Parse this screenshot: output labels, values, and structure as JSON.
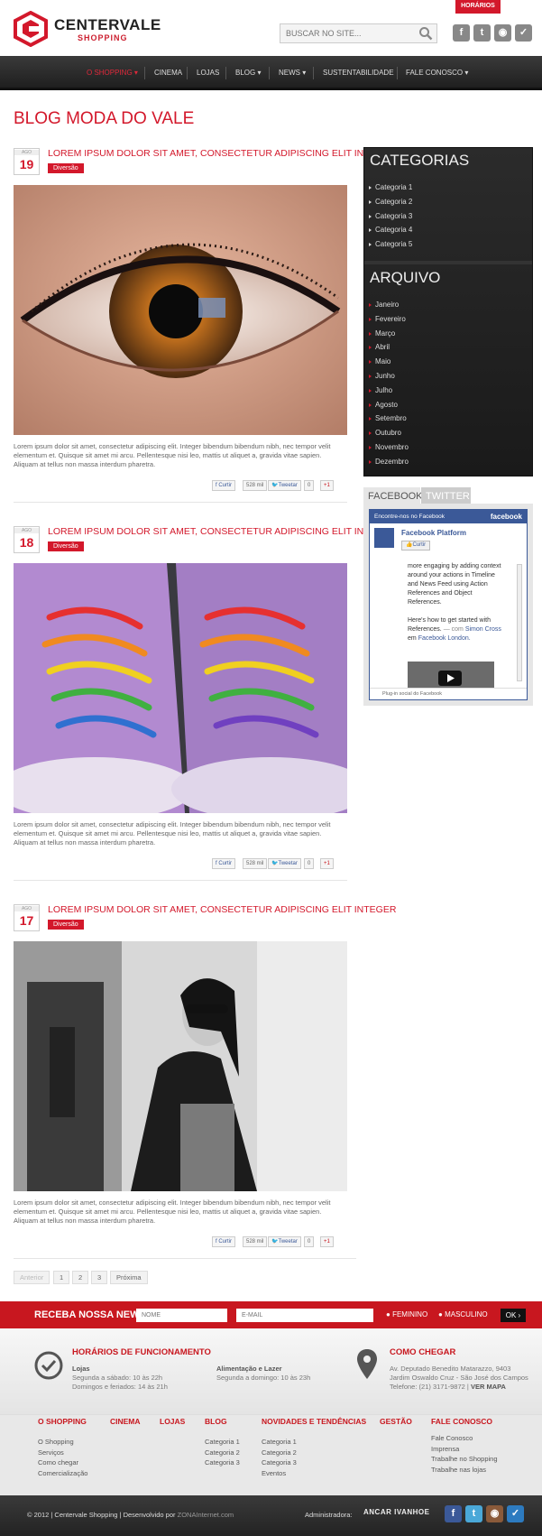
{
  "header": {
    "logo_title": "CENTERVALE",
    "logo_subtitle": "SHOPPING",
    "horarios_label": "HORÁRIOS",
    "search_placeholder": "BUSCAR NO SITE..."
  },
  "nav": [
    {
      "label": "O SHOPPING ▾",
      "active": true
    },
    {
      "label": "CINEMA"
    },
    {
      "label": "LOJAS"
    },
    {
      "label": "BLOG ▾"
    },
    {
      "label": "NEWS ▾"
    },
    {
      "label": "SUSTENTABILIDADE"
    },
    {
      "label": "FALE CONOSCO ▾"
    }
  ],
  "page_title": "BLOG MODA DO VALE",
  "posts": [
    {
      "month": "AGO",
      "day": "19",
      "title": "LOREM IPSUM DOLOR SIT AMET, CONSECTETUR ADIPISCING ELIT INTEGER",
      "category": "Diversão",
      "text": "Lorem ipsum dolor sit amet, consectetur adipiscing elit. Integer bibendum bibendum nibh, nec tempor velit elementum et. Quisque sit amet mi arcu. Pellentesque nisi leo, mattis ut aliquet a, gravida vitae sapien. Aliquam at tellus non massa interdum pharetra."
    },
    {
      "month": "AGO",
      "day": "18",
      "title": "LOREM IPSUM DOLOR SIT AMET, CONSECTETUR ADIPISCING ELIT INTEGER",
      "category": "Diversão",
      "text": "Lorem ipsum dolor sit amet, consectetur adipiscing elit. Integer bibendum bibendum nibh, nec tempor velit elementum et. Quisque sit amet mi arcu. Pellentesque nisi leo, mattis ut aliquet a, gravida vitae sapien. Aliquam at tellus non massa interdum pharetra."
    },
    {
      "month": "AGO",
      "day": "17",
      "title": "LOREM IPSUM DOLOR SIT AMET, CONSECTETUR ADIPISCING ELIT INTEGER",
      "category": "Diversão",
      "text": "Lorem ipsum dolor sit amet, consectetur adipiscing elit. Integer bibendum bibendum nibh, nec tempor velit elementum et. Quisque sit amet mi arcu. Pellentesque nisi leo, mattis ut aliquet a, gravida vitae sapien. Aliquam at tellus non massa interdum pharetra."
    }
  ],
  "share": {
    "curtir": "Curtir",
    "like_count": "528 mil",
    "tweet": "Tweetar",
    "tweet_count": "0",
    "plus": "+1"
  },
  "sidebar": {
    "categorias_title": "CATEGORIAS",
    "categorias": [
      "Categoria 1",
      "Categoria 2",
      "Categoria 3",
      "Categoria 4",
      "Categoria 5"
    ],
    "arquivo_title": "ARQUIVO",
    "arquivo": [
      "Janeiro",
      "Fevereiro",
      "Março",
      "Abril",
      "Maio",
      "Junho",
      "Julho",
      "Agosto",
      "Setembro",
      "Outubro",
      "Novembro",
      "Dezembro"
    ]
  },
  "facebook": {
    "tab_fb": "FACEBOOK",
    "tab_tw": "TWITTER",
    "bar_text": "Encontre-nos no Facebook",
    "bar_brand": "facebook",
    "page_name": "Facebook Platform",
    "like_label": "Curtir",
    "feed_l1": "more engaging by adding context around your actions in Timeline and News Feed using Action References and Object References.",
    "feed_l2": "Here's how to get started with References.",
    "feed_by": "— com",
    "feed_person": "Simon Cross",
    "feed_em": "em",
    "feed_place": "Facebook London.",
    "plugin": "Plug-in social do Facebook"
  },
  "pager": {
    "prev": "Anterior",
    "pages": [
      "1",
      "2",
      "3"
    ],
    "next": "Próxima"
  },
  "newsletter": {
    "title": "RECEBA NOSSA NEWS",
    "name_ph": "NOME",
    "email_ph": "E-MAIL",
    "opt1": "FEMININO",
    "opt2": "MASCULINO",
    "ok": "OK ›"
  },
  "info": {
    "hours_title": "HORÁRIOS DE FUNCIONAMENTO",
    "lojas_label": "Lojas",
    "lojas_1": "Segunda a sábado: 10 às 22h",
    "lojas_2": "Domingos e feriados: 14 às 21h",
    "alim_label": "Alimentação e Lazer",
    "alim_1": "Segunda a domingo: 10 às 23h",
    "como_title": "COMO CHEGAR",
    "addr_1": "Av. Deputado Benedito Matarazzo, 9403",
    "addr_2": "Jardim Oswaldo Cruz - São José dos Campos",
    "phone": "Telefone: (21) 3171-9872",
    "ver_mapa": "VER MAPA"
  },
  "footer_links": [
    {
      "head": "O SHOPPING",
      "items": [
        "O Shopping",
        "Serviços",
        "Como chegar",
        "Comercialização"
      ]
    },
    {
      "head": "CINEMA",
      "items": []
    },
    {
      "head": "LOJAS",
      "items": []
    },
    {
      "head": "BLOG",
      "items": [
        "Categoria 1",
        "Categoria 2",
        "Categoria 3"
      ]
    },
    {
      "head": "NOVIDADES E TENDÊNCIAS",
      "items": [
        "Categoria 1",
        "Categoria 2",
        "Categoria 3",
        "Eventos"
      ]
    },
    {
      "head": "GESTÃO",
      "items": []
    },
    {
      "head": "FALE CONOSCO",
      "items": [
        "Fale Conosco",
        "Imprensa",
        "Trabalhe no Shopping",
        "Trabalhe nas lojas"
      ]
    }
  ],
  "footer": {
    "copy": "© 2012  |  Centervale Shopping  |  Desenvolvido por ",
    "dev": "ZONAInternet.com",
    "admin": "Administradora:",
    "admin_logo": "ANCAR IVANHOE"
  },
  "colors": {
    "brand": "#d3182b",
    "facebook": "#3b5998",
    "twitter": "#4aa8d8"
  }
}
